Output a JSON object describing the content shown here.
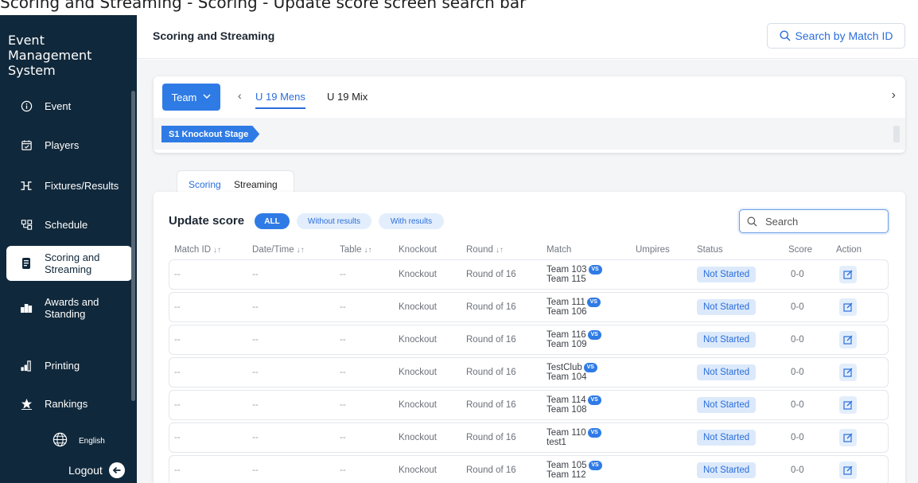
{
  "caption": "Scoring and Streaming - Scoring - Update score screen search bar",
  "sidebar": {
    "brand_line1": "Event",
    "brand_line2": "Management",
    "brand_line3": "System",
    "items": [
      {
        "label": "Event",
        "icon": "info-icon"
      },
      {
        "label": "Players",
        "icon": "calendar-check-icon"
      },
      {
        "label": "Fixtures/Results",
        "icon": "bracket-icon"
      },
      {
        "label": "Schedule",
        "icon": "schedule-icon"
      },
      {
        "label_line1": "Scoring and",
        "label_line2": "Streaming",
        "icon": "scoreboard-icon",
        "active": true
      },
      {
        "label_line1": "Awards and",
        "label_line2": "Standing",
        "icon": "podium-icon"
      },
      {
        "label": "Printing",
        "icon": "bar-chart-icon"
      },
      {
        "label": "Rankings",
        "icon": "star-icon"
      }
    ],
    "language": "English",
    "logout": "Logout"
  },
  "header": {
    "title": "Scoring and Streaming",
    "search_match_label": "Search by Match ID"
  },
  "team_selector": {
    "button_label": "Team",
    "tabs": [
      "U 19 Mens",
      "U 19 Mix"
    ],
    "active_tab": "U 19 Mens",
    "stage_label": "S1 Knockout Stage"
  },
  "subtabs": [
    "Scoring",
    "Streaming"
  ],
  "update_score": {
    "title": "Update score",
    "filters": [
      "ALL",
      "Without results",
      "With results"
    ],
    "search_placeholder": "Search",
    "columns": [
      "Match ID",
      "Date/Time",
      "Table",
      "Knockout",
      "Round",
      "Match",
      "Umpires",
      "Status",
      "Score",
      "Action"
    ],
    "vs_label": "VS",
    "rows": [
      {
        "match_id": "--",
        "datetime": "--",
        "table": "--",
        "knockout": "Knockout",
        "round": "Round of 16",
        "team_a": "Team 103",
        "team_b": "Team 115",
        "status": "Not Started",
        "score": "0-0"
      },
      {
        "match_id": "--",
        "datetime": "--",
        "table": "--",
        "knockout": "Knockout",
        "round": "Round of 16",
        "team_a": "Team 111",
        "team_b": "Team 106",
        "status": "Not Started",
        "score": "0-0"
      },
      {
        "match_id": "--",
        "datetime": "--",
        "table": "--",
        "knockout": "Knockout",
        "round": "Round of 16",
        "team_a": "Team 116",
        "team_b": "Team 109",
        "status": "Not Started",
        "score": "0-0"
      },
      {
        "match_id": "--",
        "datetime": "--",
        "table": "--",
        "knockout": "Knockout",
        "round": "Round of 16",
        "team_a": "TestClub",
        "team_b": "Team 104",
        "status": "Not Started",
        "score": "0-0"
      },
      {
        "match_id": "--",
        "datetime": "--",
        "table": "--",
        "knockout": "Knockout",
        "round": "Round of 16",
        "team_a": "Team 114",
        "team_b": "Team 108",
        "status": "Not Started",
        "score": "0-0"
      },
      {
        "match_id": "--",
        "datetime": "--",
        "table": "--",
        "knockout": "Knockout",
        "round": "Round of 16",
        "team_a": "Team 110",
        "team_b": "test1",
        "status": "Not Started",
        "score": "0-0"
      },
      {
        "match_id": "--",
        "datetime": "--",
        "table": "--",
        "knockout": "Knockout",
        "round": "Round of 16",
        "team_a": "Team 105",
        "team_b": "Team 112",
        "status": "Not Started",
        "score": "0-0"
      }
    ]
  },
  "colors": {
    "sidebar_bg": "#10283b",
    "accent": "#2f7be6",
    "status_bg": "#dbe9fb"
  }
}
